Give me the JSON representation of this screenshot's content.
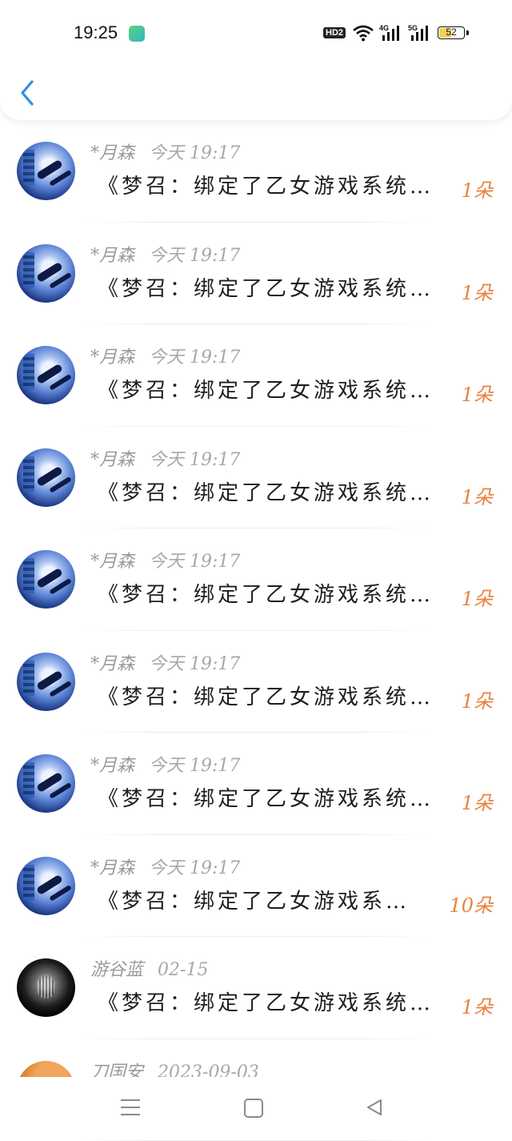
{
  "status_bar": {
    "time": "19:25",
    "hd_label": "HD2",
    "network_1": "4G",
    "network_2": "5G",
    "battery_level": "52",
    "battery_color": "#f2d25a"
  },
  "header": {
    "back_icon": "chevron-left-icon",
    "accent_color": "#2f8fe6"
  },
  "items": [
    {
      "author": "*月森",
      "time": "今天 19:17",
      "title": "《梦召：绑定了乙女游戏系统…",
      "count": "1朵",
      "avatar": "anime"
    },
    {
      "author": "*月森",
      "time": "今天 19:17",
      "title": "《梦召：绑定了乙女游戏系统…",
      "count": "1朵",
      "avatar": "anime"
    },
    {
      "author": "*月森",
      "time": "今天 19:17",
      "title": "《梦召：绑定了乙女游戏系统…",
      "count": "1朵",
      "avatar": "anime"
    },
    {
      "author": "*月森",
      "time": "今天 19:17",
      "title": "《梦召：绑定了乙女游戏系统…",
      "count": "1朵",
      "avatar": "anime"
    },
    {
      "author": "*月森",
      "time": "今天 19:17",
      "title": "《梦召：绑定了乙女游戏系统…",
      "count": "1朵",
      "avatar": "anime"
    },
    {
      "author": "*月森",
      "time": "今天 19:17",
      "title": "《梦召：绑定了乙女游戏系统…",
      "count": "1朵",
      "avatar": "anime"
    },
    {
      "author": "*月森",
      "time": "今天 19:17",
      "title": "《梦召：绑定了乙女游戏系统…",
      "count": "1朵",
      "avatar": "anime"
    },
    {
      "author": "*月森",
      "time": "今天 19:17",
      "title": "《梦召：绑定了乙女游戏系…",
      "count": "10朵",
      "avatar": "anime"
    },
    {
      "author": "游谷蓝",
      "time": "02-15",
      "title": "《梦召：绑定了乙女游戏系统…",
      "count": "1朵",
      "avatar": "dark"
    },
    {
      "author": "刀国安",
      "time": "2023-09-03",
      "title": "",
      "count": "",
      "avatar": "cat"
    }
  ],
  "count_color": "#e98240",
  "nav_bar": {
    "menu_icon": "menu-icon",
    "home_icon": "home-square-icon",
    "back_icon": "back-triangle-icon"
  }
}
